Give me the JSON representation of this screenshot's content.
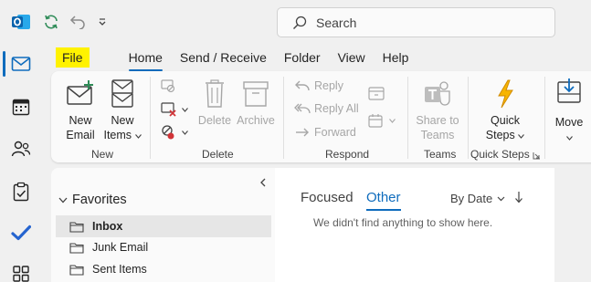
{
  "app": {
    "name": "Outlook",
    "accent": "#0f6cbd",
    "highlight": "#fff200"
  },
  "search": {
    "placeholder": "Search"
  },
  "quick_access": [
    "sync-icon",
    "undo-icon",
    "customize-chevron-icon"
  ],
  "menu_tabs": [
    {
      "label": "File"
    },
    {
      "label": "Home",
      "selected": true
    },
    {
      "label": "Send / Receive"
    },
    {
      "label": "Folder"
    },
    {
      "label": "View"
    },
    {
      "label": "Help"
    }
  ],
  "ribbon": {
    "new": {
      "label": "New",
      "new_email_line1": "New",
      "new_email_line2": "Email",
      "new_items_line1": "New",
      "new_items_line2": "Items"
    },
    "delete": {
      "label": "Delete",
      "delete_btn": "Delete",
      "archive_btn": "Archive"
    },
    "respond": {
      "label": "Respond",
      "reply": "Reply",
      "reply_all": "Reply All",
      "forward": "Forward"
    },
    "teams": {
      "label": "Teams",
      "share_line1": "Share to",
      "share_line2": "Teams"
    },
    "quick_steps": {
      "label": "Quick Steps",
      "btn_line1": "Quick",
      "btn_line2": "Steps"
    },
    "move": {
      "btn": "Move"
    }
  },
  "rail": [
    "mail-icon",
    "calendar-icon",
    "people-icon",
    "tasks-icon",
    "todo-icon",
    "apps-icon"
  ],
  "nav": {
    "favorites_label": "Favorites",
    "folders": [
      {
        "label": "Inbox",
        "selected": true
      },
      {
        "label": "Junk Email"
      },
      {
        "label": "Sent Items"
      }
    ]
  },
  "message_list": {
    "tab_focused": "Focused",
    "tab_other": "Other",
    "sort_by": "By Date",
    "empty_message": "We didn't find anything to show here."
  }
}
